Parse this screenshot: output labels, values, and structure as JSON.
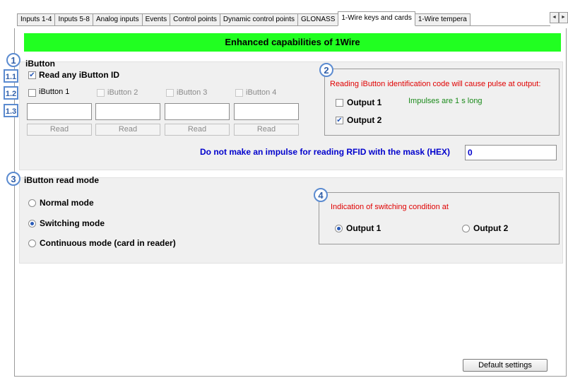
{
  "top_cut_text": "~ ~ ~ ~ ~ ~ ~ ~",
  "tabs": [
    "Inputs 1-4",
    "Inputs 5-8",
    "Analog inputs",
    "Events",
    "Control points",
    "Dynamic control points",
    "GLONASS",
    "1-Wire keys and cards",
    "1-Wire tempera"
  ],
  "active_tab": "1-Wire keys and cards",
  "scroll_arrows": [
    "◄",
    "►"
  ],
  "banner": "Enhanced capabilities of 1Wire",
  "callouts": {
    "c1": "1",
    "c1_1": "1.1",
    "c1_2": "1.2",
    "c1_3": "1.3",
    "c2": "2",
    "c3": "3",
    "c4": "4"
  },
  "ibutton": {
    "legend": "iButton",
    "read_any_label": "Read any iButton ID",
    "read_any_checked": true,
    "items": [
      {
        "label": "iButton 1",
        "value": "",
        "read": "Read"
      },
      {
        "label": "iButton 2",
        "value": "",
        "read": "Read"
      },
      {
        "label": "iButton 3",
        "value": "",
        "read": "Read"
      },
      {
        "label": "iButton 4",
        "value": "",
        "read": "Read"
      }
    ],
    "pulse_text": "Reading iButton identification code will cause pulse at output:",
    "output1": "Output 1",
    "output2": "Output 2",
    "output1_checked": false,
    "output2_checked": true,
    "impulse_note": "Impulses are 1 s long",
    "mask_label": "Do not make an impulse for reading RFID with the mask (HEX)",
    "mask_value": "0"
  },
  "read_mode": {
    "legend": "iButton read mode",
    "modes": [
      "Normal mode",
      "Switching mode",
      "Continuous mode (card in reader)"
    ],
    "selected": "Switching mode",
    "indication_text": "Indication of switching condition at",
    "out1": "Output 1",
    "out2": "Output 2",
    "indication_selected": "Output 1"
  },
  "default_button": "Default settings",
  "colors": {
    "banner": "#21ff21",
    "callout": "#5b8bd0",
    "red_note": "#e00000",
    "green_note": "#1a8a1a",
    "blue_label": "#0000cc"
  }
}
